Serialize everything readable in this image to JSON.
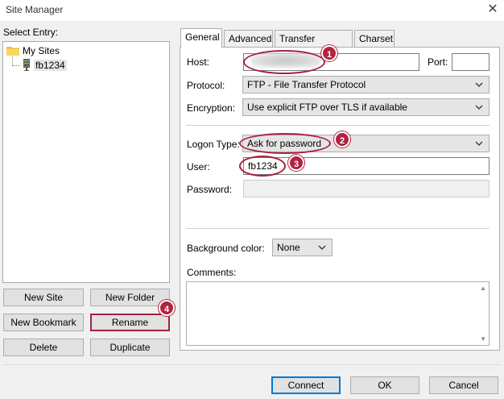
{
  "window": {
    "title": "Site Manager",
    "close_glyph": "✕"
  },
  "left": {
    "select_entry_label": "Select Entry:",
    "tree": [
      {
        "label": "My Sites",
        "icon": "folder-icon"
      },
      {
        "label": "fb1234",
        "icon": "server-icon",
        "selected": true
      }
    ],
    "buttons": {
      "new_site": "New Site",
      "new_folder": "New Folder",
      "new_bookmark": "New Bookmark",
      "rename": "Rename",
      "delete": "Delete",
      "duplicate": "Duplicate"
    }
  },
  "tabs": [
    {
      "label": "General",
      "active": true
    },
    {
      "label": "Advanced"
    },
    {
      "label": "Transfer Settings"
    },
    {
      "label": "Charset"
    }
  ],
  "general": {
    "host_label": "Host:",
    "host_value": "",
    "port_label": "Port:",
    "port_value": "",
    "protocol_label": "Protocol:",
    "protocol_value": "FTP - File Transfer Protocol",
    "encryption_label": "Encryption:",
    "encryption_value": "Use explicit FTP over TLS if available",
    "logon_type_label": "Logon Type:",
    "logon_type_value": "Ask for password",
    "user_label": "User:",
    "user_value": "fb1234",
    "password_label": "Password:",
    "password_value": "",
    "background_color_label": "Background color:",
    "background_color_value": "None",
    "comments_label": "Comments:",
    "comments_value": ""
  },
  "footer": {
    "connect": "Connect",
    "ok": "OK",
    "cancel": "Cancel"
  },
  "annotations": {
    "color": "#b0243f",
    "badges": [
      "1",
      "2",
      "3",
      "4"
    ]
  }
}
